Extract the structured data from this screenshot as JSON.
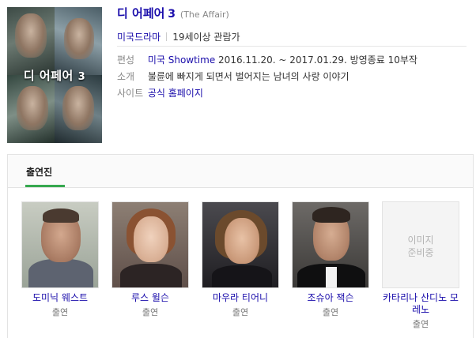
{
  "poster": {
    "title_text": "디 어페어",
    "title_num": "3"
  },
  "show": {
    "title": "디 어페어",
    "title_num": "3",
    "original_title": "(The Affair)"
  },
  "tagline": {
    "genre": "미국드라마",
    "rating": "19세이상 관람가"
  },
  "info": {
    "schedule_label": "편성",
    "schedule_link": "미국 Showtime",
    "schedule_text": "2016.11.20. ~ 2017.01.29. 방영종료 10부작",
    "intro_label": "소개",
    "intro_text": "불륜에 빠지게 되면서 벌어지는 남녀의 사랑 이야기",
    "site_label": "사이트",
    "site_link": "공식 홈페이지"
  },
  "cast": {
    "tab_label": "출연진",
    "members": [
      {
        "name": "도미닉 웨스트",
        "role": "출연"
      },
      {
        "name": "루스 윌슨",
        "role": "출연"
      },
      {
        "name": "마우라 티어니",
        "role": "출연"
      },
      {
        "name": "조슈아 잭슨",
        "role": "출연"
      },
      {
        "name": "카타리나 산디노 모레노",
        "role": "출연",
        "placeholder": "이미지 준비중"
      }
    ]
  },
  "colors": {
    "link": "#1a0dab",
    "tab_accent": "#36a84f"
  }
}
